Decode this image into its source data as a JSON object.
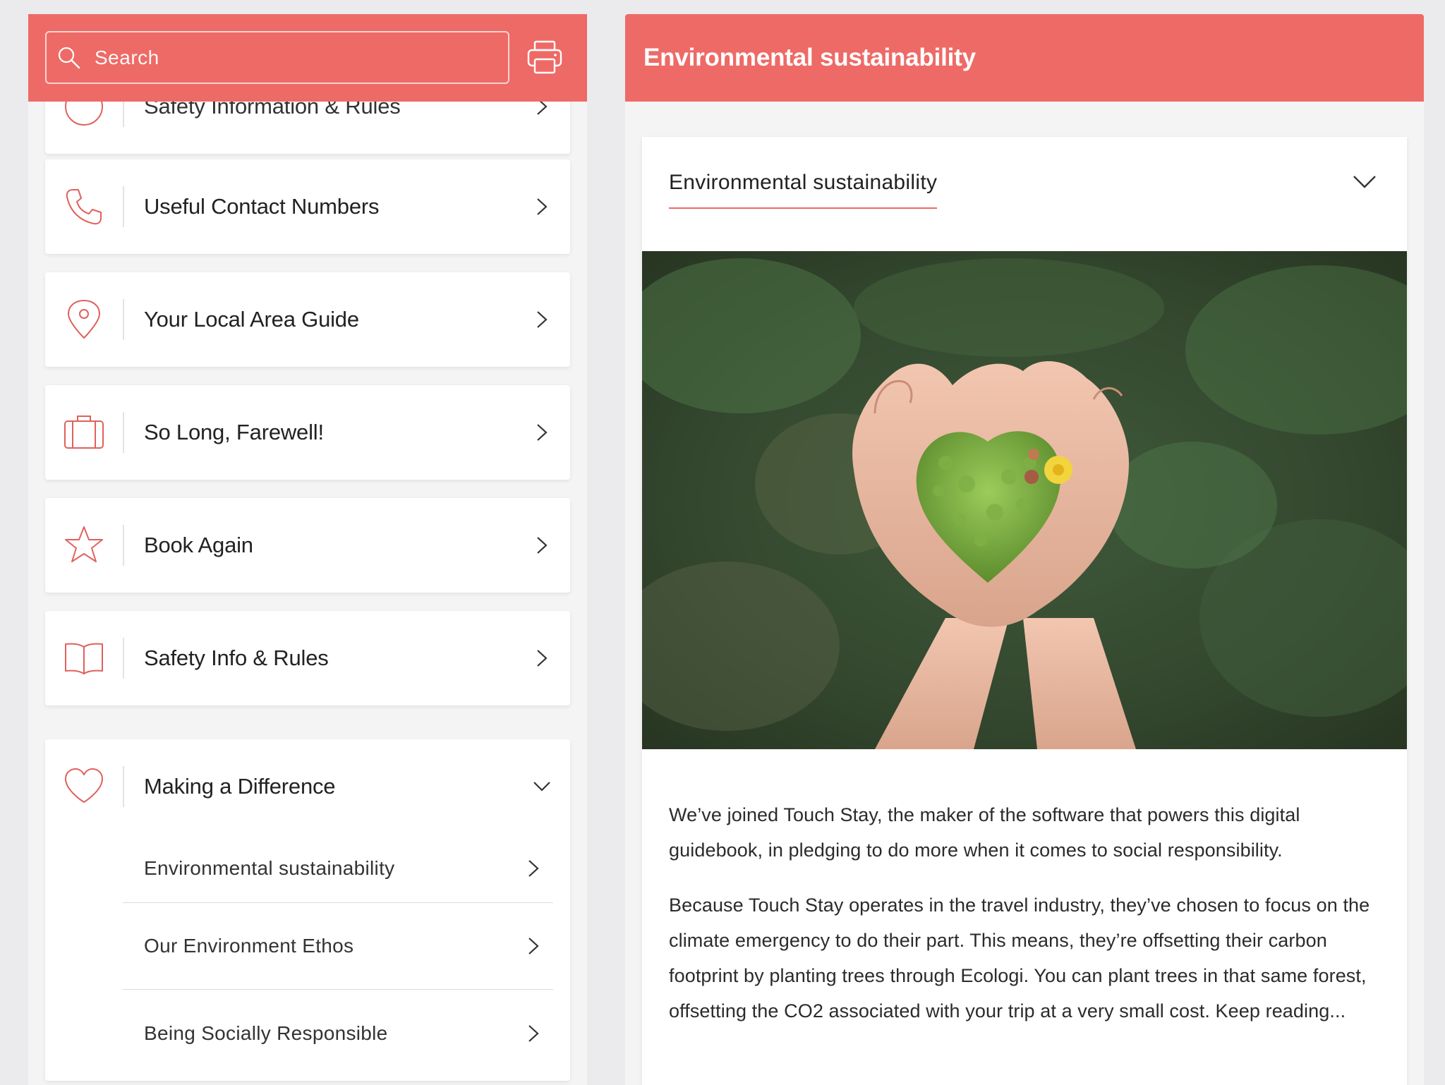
{
  "search": {
    "placeholder": "Search"
  },
  "menu": {
    "partial_item": "Safety Information & Rules",
    "items": [
      {
        "label": "Useful Contact Numbers",
        "icon": "phone-icon"
      },
      {
        "label": "Your Local Area Guide",
        "icon": "map-pin-icon"
      },
      {
        "label": "So Long, Farewell!",
        "icon": "suitcase-icon"
      },
      {
        "label": "Book Again",
        "icon": "star-icon"
      },
      {
        "label": "Safety Info & Rules",
        "icon": "book-icon"
      }
    ],
    "expanded": {
      "label": "Making a Difference",
      "icon": "heart-icon",
      "sub_items": [
        "Environmental sustainability",
        "Our Environment Ethos",
        "Being Socially Responsible"
      ]
    }
  },
  "article": {
    "title": "Environmental sustainability",
    "dropdown_label": "Environmental sustainability",
    "paragraphs": [
      "We’ve joined Touch Stay, the maker of the software that powers this digital guidebook, in pledging to do more when it comes to social responsibility.",
      "Because Touch Stay operates in the travel industry, they’ve chosen to focus on the climate emergency to do their part. This means, they’re offsetting their carbon footprint by planting trees through Ecologi. You can plant trees in that same forest, offsetting the CO2 associated with your trip at a very small cost. Keep reading..."
    ]
  },
  "colors": {
    "brand": "#ee6a66",
    "icon_stroke": "#e0615c"
  }
}
